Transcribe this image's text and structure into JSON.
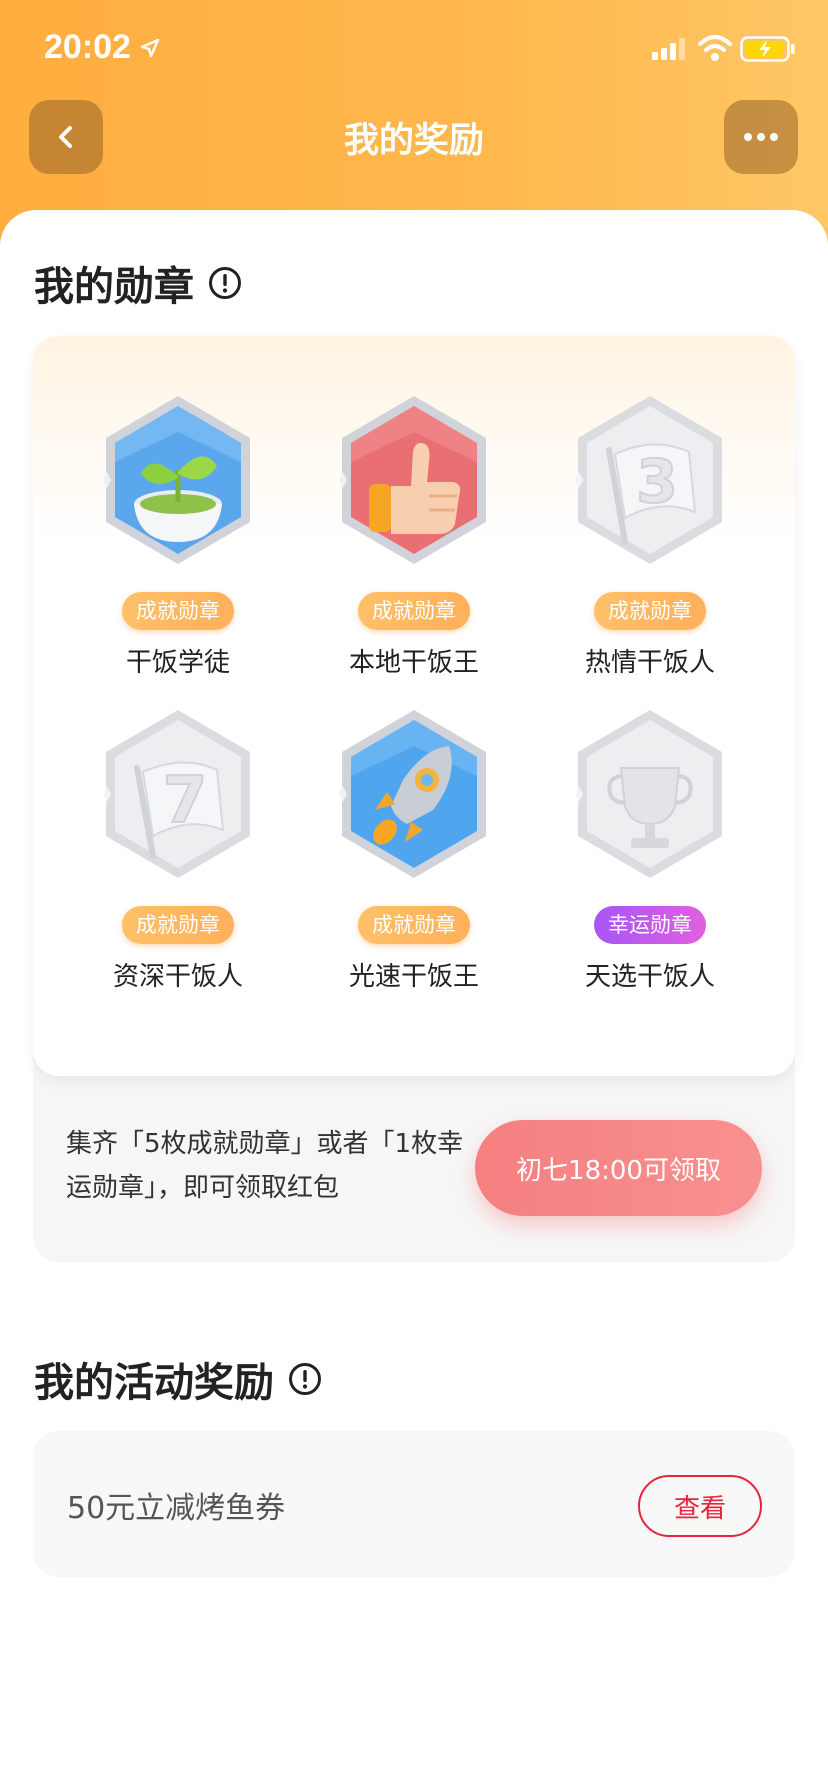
{
  "status_bar": {
    "time": "20:02",
    "icons": [
      "location-arrow-icon",
      "signal-icon",
      "wifi-icon",
      "battery-charging-icon"
    ]
  },
  "nav": {
    "title": "我的奖励",
    "back_icon": "chevron-left-icon",
    "more_icon": "more-dots-icon"
  },
  "badges_section": {
    "title": "我的勋章",
    "info_icon": "info-icon",
    "badges": [
      {
        "name": "干饭学徒",
        "tag": "成就勋章",
        "icon": "sprout-bowl-medal",
        "unlocked": true
      },
      {
        "name": "本地干饭王",
        "tag": "成就勋章",
        "icon": "thumbs-up-medal",
        "unlocked": true
      },
      {
        "name": "热情干饭人",
        "tag": "成就勋章",
        "icon": "flag-3-medal",
        "unlocked": false
      },
      {
        "name": "资深干饭人",
        "tag": "成就勋章",
        "icon": "flag-7-medal",
        "unlocked": false
      },
      {
        "name": "光速干饭王",
        "tag": "成就勋章",
        "icon": "rocket-medal",
        "unlocked": true
      },
      {
        "name": "天选干饭人",
        "tag": "幸运勋章",
        "icon": "trophy-luck-medal",
        "unlocked": false
      }
    ],
    "collect_text": "集齐「5枚成就勋章」或者「1枚幸运勋章」，即可领取红包",
    "claim_button": "初七18:00可领取"
  },
  "activity_section": {
    "title": "我的活动奖励",
    "info_icon": "info-icon",
    "rewards": [
      {
        "label": "50元立减烤鱼券",
        "button": "查看"
      }
    ]
  },
  "colors": {
    "header_orange": "#ffad3e",
    "achievement_tag": "#ffb05a",
    "luck_tag": "#a855f7",
    "claim_button": "#f58080",
    "view_button": "#e8233b"
  }
}
